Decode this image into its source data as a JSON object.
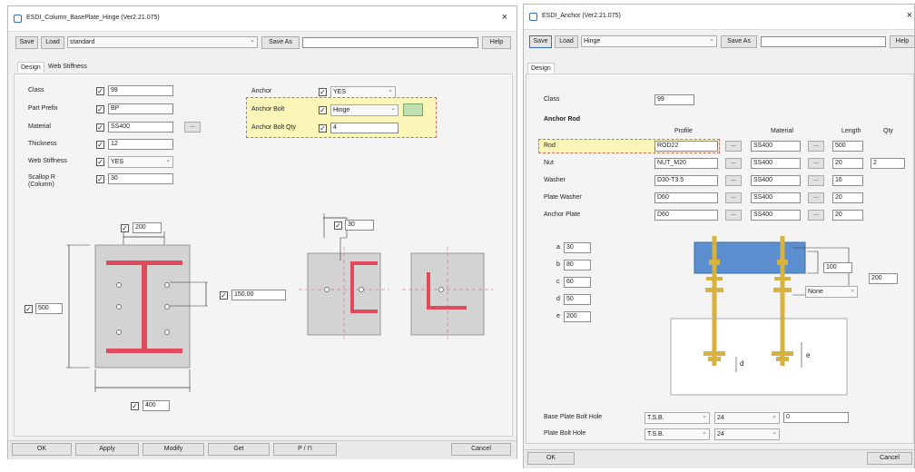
{
  "colors": {
    "highlight": "#fbf6b8",
    "steel": "#d3d3d3",
    "red": "#e04a5a",
    "blue": "#5b8fd0",
    "gold": "#d8b23c"
  },
  "left": {
    "title": "ESDI_Column_BasePlate_Hinge (Ver2.21.075)",
    "close": "×",
    "toolbar": {
      "save": "Save",
      "load": "Load",
      "preset": "standard",
      "save_as": "Save As",
      "save_as_value": "",
      "help": "Help"
    },
    "tabs": [
      "Design",
      "Web Stiffness"
    ],
    "fields": [
      {
        "label": "Class",
        "value": "99",
        "type": "text"
      },
      {
        "label": "Part Prefix",
        "value": "BP",
        "type": "text"
      },
      {
        "label": "Material",
        "value": "SS400",
        "type": "text"
      },
      {
        "label": "Thickness",
        "value": "12",
        "type": "text"
      },
      {
        "label": "Web Stiffness",
        "value": "YES",
        "type": "select"
      },
      {
        "label": "Scallop R\n(Column)",
        "value": "30",
        "type": "text"
      }
    ],
    "anchor": {
      "label": "Anchor",
      "value": "YES",
      "bolt_label": "Anchor Bolt",
      "bolt_value": "Hinge",
      "qty_label": "Anchor Bolt Qty",
      "qty_value": "4"
    },
    "dims": {
      "top": "200",
      "left": "500",
      "right": "150.00",
      "bottom": "400",
      "stiff": "30"
    },
    "footer": [
      "OK",
      "Apply",
      "Modify",
      "Get",
      "P / ⊓",
      "Cancel"
    ]
  },
  "right": {
    "title": "ESDI_Anchor (Ver2.21.075)",
    "close": "×",
    "toolbar": {
      "save": "Save",
      "load": "Load",
      "preset": "Hinge",
      "save_as": "Save As",
      "save_as_value": "",
      "help": "Help"
    },
    "tab": "Design",
    "class_label": "Class",
    "class_value": "99",
    "section": "Anchor Rod",
    "cols": {
      "profile": "Profile",
      "material": "Material",
      "length": "Length",
      "qty": "Qty"
    },
    "rows": [
      {
        "label": "Rod",
        "profile": "ROD22",
        "material": "SS400",
        "length": "500",
        "qty": ""
      },
      {
        "label": "Nut",
        "profile": "NUT_M20",
        "material": "SS400",
        "length": "20",
        "qty": "2"
      },
      {
        "label": "Washer",
        "profile": "D30-T3.5",
        "material": "SS400",
        "length": "16",
        "qty": ""
      },
      {
        "label": "Plate Washer",
        "profile": "D60",
        "material": "SS400",
        "length": "20",
        "qty": ""
      },
      {
        "label": "Anchor Plate",
        "profile": "D60",
        "material": "SS400",
        "length": "20",
        "qty": ""
      }
    ],
    "params": [
      {
        "k": "a",
        "v": "30"
      },
      {
        "k": "b",
        "v": "80"
      },
      {
        "k": "c",
        "v": "60"
      },
      {
        "k": "d",
        "v": "50"
      },
      {
        "k": "e",
        "v": "200"
      }
    ],
    "diag": {
      "v1": "100",
      "v2": "200",
      "sel": "None"
    },
    "holes": [
      {
        "label": "Base Plate Bolt Hole",
        "s1": "T.S.B.",
        "s2": "24",
        "v": "0"
      },
      {
        "label": "Plate Bolt Hole",
        "s1": "T.S.B.",
        "s2": "24",
        "v": ""
      }
    ],
    "footer": {
      "ok": "OK",
      "cancel": "Cancel"
    }
  }
}
